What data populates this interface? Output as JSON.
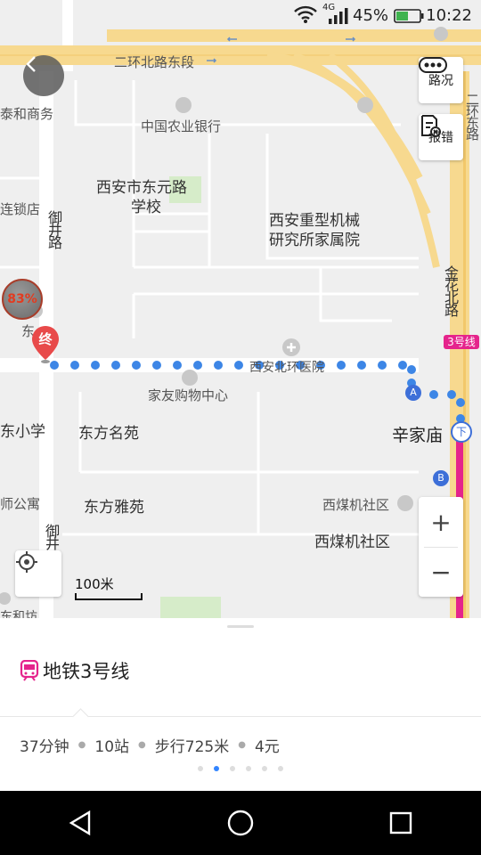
{
  "status_bar": {
    "network": "4G",
    "battery_pct": "45%",
    "time": "10:22"
  },
  "map": {
    "roads": {
      "ring_road": "二环北路东段",
      "ring_road_vertical": "二环东路",
      "yujing_road": "御井路",
      "yujing_road_lower": "御井",
      "jinhua_road": "金花北路"
    },
    "places": {
      "taihe": "泰和商务",
      "abc_bank": "中国农业银行",
      "school_line1": "西安市东元路",
      "school_line2": "学校",
      "chain_store": "连锁店",
      "institute_line1": "西安重型机械",
      "institute_line2": "研究所家属院",
      "hospital": "西安北环医院",
      "jiayou": "家友购物中心",
      "primary_school": "东小学",
      "dongfang_mingyuan": "东方名苑",
      "dongfang_yayuan": "东方雅苑",
      "apartment": "师公寓",
      "xinjiamiao": "辛家庙",
      "xmj_community_poi": "西煤机社区",
      "xmj_community": "西煤机社区",
      "partial_east": "东",
      "partial_bottom": "东和坊"
    },
    "markers": {
      "end_label": "终",
      "percent_badge": "83%",
      "line_badge": "3号线",
      "exit_a": "A",
      "exit_b": "B",
      "metro_down": "下"
    },
    "controls": {
      "traffic_label": "路况",
      "report_label": "报错",
      "zoom_in": "+",
      "zoom_out": "−",
      "scale_label": "100米"
    }
  },
  "route": {
    "title": "地铁3号线",
    "duration": "37分钟",
    "stations": "10站",
    "walk": "步行725米",
    "fare": "4元",
    "page_count": 6,
    "active_page": 1
  },
  "colors": {
    "route_dots": "#3d86e6",
    "metro_line": "#e5248c",
    "end_marker": "#e84a4a",
    "accent": "#3385ff"
  },
  "icons": [
    "back-icon",
    "traffic-icon",
    "report-icon",
    "locate-icon",
    "subway-icon",
    "nav-back-icon",
    "nav-home-icon",
    "nav-recents-icon"
  ]
}
